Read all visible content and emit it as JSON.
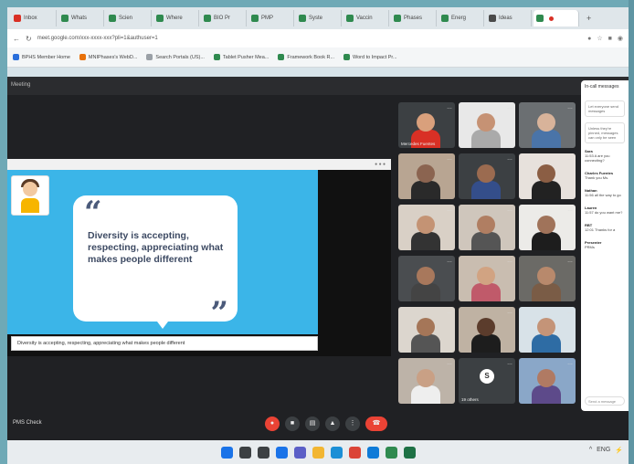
{
  "browser": {
    "tabs": [
      {
        "label": "Inbox",
        "color": "#d93025"
      },
      {
        "label": "Whats",
        "color": "#2f8a4f"
      },
      {
        "label": "Scien",
        "color": "#2f8a4f"
      },
      {
        "label": "Where",
        "color": "#2f8a4f"
      },
      {
        "label": "BIO Pr",
        "color": "#2f8a4f"
      },
      {
        "label": "PMP",
        "color": "#2f8a4f"
      },
      {
        "label": "Syste",
        "color": "#2f8a4f"
      },
      {
        "label": "Vaccin",
        "color": "#2f8a4f"
      },
      {
        "label": "Phases",
        "color": "#2f8a4f"
      },
      {
        "label": "Energ",
        "color": "#2f8a4f"
      },
      {
        "label": "Ideas",
        "color": "#4a4a4a"
      },
      {
        "label": "",
        "color": "#2f8a4f",
        "active": true,
        "recording": true
      }
    ],
    "new_tab": "+",
    "url": "meet.google.com/xxx-xxxx-xxx?pli=1&authuser=1",
    "bookmarks": [
      {
        "label": "BPHS Member Home",
        "color": "#2a6fdb"
      },
      {
        "label": "MNIPhases's WebD...",
        "color": "#e8710a"
      },
      {
        "label": "Search Portals (US)...",
        "color": "#9aa0a6"
      },
      {
        "label": "Tablet Pusher Mea...",
        "color": "#2f8a4f"
      },
      {
        "label": "Framework Book R...",
        "color": "#2f8a4f"
      },
      {
        "label": "Word to Impact Pr...",
        "color": "#2f8a4f"
      }
    ]
  },
  "meet": {
    "header": "Meeting",
    "slide": {
      "quote_open": "“",
      "quote_close": "”",
      "quote": "Diversity is accepting, respecting, appreciating what makes people different",
      "caption": "Diversity is accepting, respecting, appreciating what makes people different"
    },
    "participants": [
      {
        "name": "Mercedes Fuentes",
        "col": 0,
        "row": 0,
        "bg": "#3c4043",
        "skin": "#d9a07c",
        "shirt": "#d93025"
      },
      {
        "name": "",
        "col": 1,
        "row": 0,
        "bg": "#e8e8e8",
        "skin": "#c69274",
        "shirt": "#aaa"
      },
      {
        "name": "",
        "col": 2,
        "row": 0,
        "bg": "#6b6f72",
        "skin": "#d8b39a",
        "shirt": "#4a74a8"
      },
      {
        "name": "",
        "col": 0,
        "row": 1,
        "bg": "#b8a592",
        "skin": "#8b6450",
        "shirt": "#2a2a2a"
      },
      {
        "name": "",
        "col": 1,
        "row": 1,
        "bg": "#3c4043",
        "skin": "#9b6b50",
        "shirt": "#344e8a"
      },
      {
        "name": "",
        "col": 2,
        "row": 1,
        "bg": "#e7e1dc",
        "skin": "#8b5e44",
        "shirt": "#222"
      },
      {
        "name": "",
        "col": 0,
        "row": 2,
        "bg": "#d9d0c6",
        "skin": "#c49374",
        "shirt": "#333"
      },
      {
        "name": "",
        "col": 1,
        "row": 2,
        "bg": "#cfc6bc",
        "skin": "#b07e62",
        "shirt": "#555"
      },
      {
        "name": "",
        "col": 2,
        "row": 2,
        "bg": "#ecebe8",
        "skin": "#a0735a",
        "shirt": "#1d1d1d"
      },
      {
        "name": "",
        "col": 0,
        "row": 3,
        "bg": "#4a4d50",
        "skin": "#a8785c",
        "shirt": "#444"
      },
      {
        "name": "",
        "col": 1,
        "row": 3,
        "bg": "#c9bdb0",
        "skin": "#d1a382",
        "shirt": "#c05a6a"
      },
      {
        "name": "",
        "col": 2,
        "row": 3,
        "bg": "#6b6a66",
        "skin": "#b8896c",
        "shirt": "#7a5c46"
      },
      {
        "name": "",
        "col": 0,
        "row": 4,
        "bg": "#dcd6ce",
        "skin": "#a57658",
        "shirt": "#555"
      },
      {
        "name": "",
        "col": 1,
        "row": 4,
        "bg": "#bfb2a3",
        "skin": "#5b3c2c",
        "shirt": "#1d1d1d"
      },
      {
        "name": "",
        "col": 2,
        "row": 4,
        "bg": "#d8e2e8",
        "skin": "#c49478",
        "shirt": "#2e6ca4"
      },
      {
        "name": "",
        "col": 0,
        "row": 5,
        "bg": "#bdb3a8",
        "skin": "#c9a085",
        "shirt": "#eee"
      },
      {
        "name": "19 others",
        "col": 1,
        "row": 5,
        "bg": "#3c4043",
        "avatar": true,
        "initial": "S"
      },
      {
        "name": "",
        "col": 2,
        "row": 5,
        "bg": "#8aa7c8",
        "skin": "#b07a63",
        "shirt": "#5d4a8a"
      }
    ],
    "meeting_code": "PMS Check",
    "controls": [
      {
        "icon": "mic-off-icon",
        "glyph": "●",
        "red": true
      },
      {
        "icon": "camera-icon",
        "glyph": "■",
        "red": false
      },
      {
        "icon": "captions-icon",
        "glyph": "▤",
        "red": false
      },
      {
        "icon": "present-icon",
        "glyph": "▲",
        "red": false
      },
      {
        "icon": "more-icon",
        "glyph": "⋮",
        "red": false
      }
    ],
    "hangup_glyph": "☎",
    "side_panel": {
      "title": "In-call messages",
      "box1": "Let everyone send messages",
      "box2": "Unless they're pinned, messages can only be seen",
      "messages": [
        {
          "who": "Sara",
          "text": "11:53 A are you connecting?"
        },
        {
          "who": "Charles Fuentes",
          "text": "Thank you Ms."
        },
        {
          "who": "Nathan",
          "text": "11:56 all the way to go"
        },
        {
          "who": "Lauren",
          "text": "11:57 do you want me?"
        },
        {
          "who": "RBT",
          "text": "12:01 Thanks for a"
        },
        {
          "who": "Presenter",
          "text": "PRMs"
        }
      ],
      "input_placeholder": "Send a message"
    }
  },
  "taskbar": {
    "icons": [
      {
        "icon": "windows-start-icon",
        "color": "#1a73e8"
      },
      {
        "icon": "search-icon",
        "color": "#3c4043"
      },
      {
        "icon": "task-view-icon",
        "color": "#3c4043"
      },
      {
        "icon": "widgets-icon",
        "color": "#1a73e8"
      },
      {
        "icon": "chat-icon",
        "color": "#5b5fc7"
      },
      {
        "icon": "file-explorer-icon",
        "color": "#f2b632"
      },
      {
        "icon": "edge-icon",
        "color": "#1c8fd6"
      },
      {
        "icon": "chrome-icon",
        "color": "#db4437"
      },
      {
        "icon": "mail-icon",
        "color": "#0f7bd8"
      },
      {
        "icon": "phone-link-icon",
        "color": "#2f8a4f"
      },
      {
        "icon": "excel-icon",
        "color": "#1e7145"
      }
    ],
    "tray": [
      "^",
      "ENG",
      "⚡"
    ]
  }
}
